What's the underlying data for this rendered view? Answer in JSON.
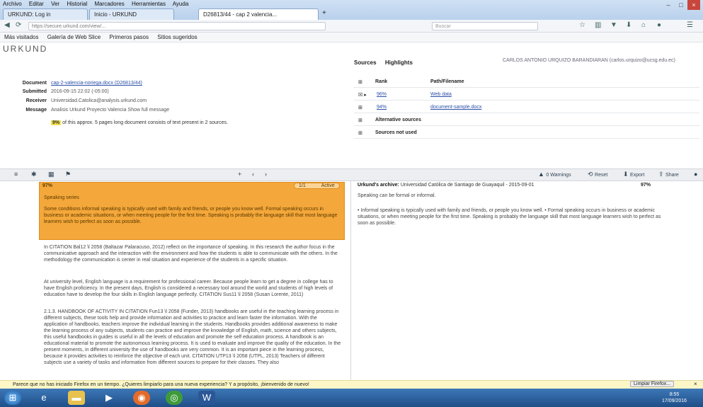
{
  "menu": [
    "Archivo",
    "Editar",
    "Ver",
    "Historial",
    "Marcadores",
    "Herramientas",
    "Ayuda"
  ],
  "tabs": [
    {
      "label": "URKUND: Log in"
    },
    {
      "label": "Inicio - URKUND"
    },
    {
      "label": "D26813/44 - cap 2 valencia..."
    }
  ],
  "bookmarks": [
    "Más visitados",
    "Galería de Web Slice",
    "Primeros pasos",
    "Sitios sugeridos"
  ],
  "logo": "URKUND",
  "doc": {
    "document_label": "Document",
    "document_value": "cap-2-valencia-noriega.docx (D26813/44)",
    "submitted_label": "Submitted",
    "submitted_value": "2016-09-15 22:02 (-05:00)",
    "receiver_label": "Receiver",
    "receiver_value": "Universidad.Catolica@analysis.urkund.com",
    "message_label": "Message",
    "message_value": "Analisis Urkund Proyecto Valencia Show full message",
    "highlight_pct": "9%",
    "highlight_text": "of this approx. 5 pages long document consists of text present in 2 sources."
  },
  "sources": {
    "tab_sources": "Sources",
    "tab_highlights": "Highlights",
    "user": "CARLOS ANTONIO URQUIZO BARANDIARAN (carlos.urquizo@ucsg.edu.ec)",
    "col_rank": "Rank",
    "col_path": "Path/Filename",
    "rows": [
      {
        "rank": "96%",
        "path": "Web data"
      },
      {
        "rank": "94%",
        "path": "document-sample.docx"
      }
    ],
    "alt": "Alternative sources",
    "unused": "Sources not used"
  },
  "toolbar": {
    "warnings": "0 Warnings",
    "reset": "Reset",
    "export": "Export",
    "share": "Share"
  },
  "match": {
    "pct": "97%",
    "counter": "1/1",
    "active": "Active",
    "title": "Speaking series",
    "text": "Some conditions informal speaking is typically used with family and friends, or people you know well. Formal speaking occurs in business or academic situations, or when meeting people for the first time. Speaking is probably the language skill that most language learners wish to perfect as soon as possible."
  },
  "paras": [
    "In CITATION Bal12 \\l 2058 (Baltazar Palaracuso, 2012) reflect on the importance of speaking. In this research the author focus in the communicative approach and the interaction with the environment and how the students is able to communicate with the others. In the methodology the communication is center in real situation and experience of the students in a specific situation.",
    "At university level, English language is a requirement for professional career. Because people learn to get a degree in college has to have English proficiency. In the present days, English is considered a necessary tool around the world and students of high levels of education have to develop the four skills in English language perfectly. CITATION Sus11 \\l 2058 (Susan Lorente, 2011)",
    "2.1.3. HANDBOOK OF ACTIVITY IN CITATION Fun13 \\l 2058 (Funder, 2013) handbooks are useful in the teaching learning process in different subjects, these tools help and provide information and activities to practice and learn faster the information. With the application of handbooks, teachers improve the individual learning in the students. Handbooks provides additional awareness to make the learning process of any subjects, students can practice and improve the knowledge of English, math, science and others subjects, this useful handbooks in guides is useful in all the levels of education and promote the self education process. A handbook is an educational material to promote the autonomous learning process. It is used to evaluate and improve the quality of the education. In the present moments, in different university the use of handbooks are very common. It is an important piece in the learning process, because it provides activities to reinforce the objective of each unit. CITATION UTP13 \\l 2058 (UTPL, 2013) Teachers of different subjects use a variety of tasks and information from different sources to prepare for their classes. They also"
  ],
  "right": {
    "archive_label": "Urkund's archive:",
    "archive_value": "Universidad Católica de Santiago de Guayaquil - 2015-09-01",
    "pct": "97%",
    "sub": "Speaking can be formal or informal.",
    "text": "• Informal speaking is typically used with family and friends, or people you know well. • Formal speaking occurs in business or academic situations, or when meeting people for the first time. Speaking is probably the language skill that most language learners wish to perfect as soon as possible."
  },
  "notif": {
    "text": "Parece que no has iniciado Firefox en un tiempo. ¿Quieres limpiarlo para una nueva experiencia? Y a propósito, ¡bienvenido de nuevo!",
    "btn": "Limpiar Firefox..."
  },
  "clock": {
    "time": "8:55",
    "date": "17/09/2016"
  }
}
